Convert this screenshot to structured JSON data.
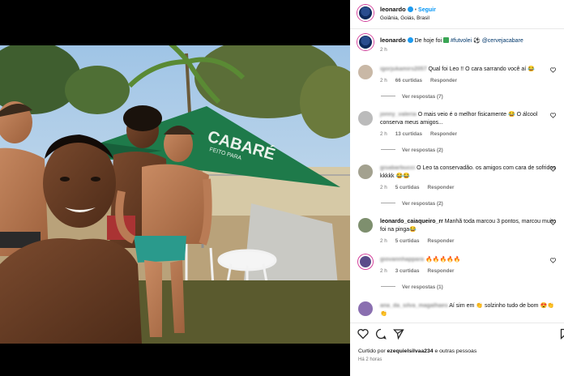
{
  "post": {
    "username": "leonardo",
    "follow_label": "Seguir",
    "location": "Goiânia, Goiás, Brasil",
    "caption_text": "De hoje foi",
    "caption_tag1": "#futvolei",
    "caption_tag2": "@cervejacabare",
    "caption_time": "2 h",
    "tent_text": "CABARÉ",
    "tent_small": "FEITO PARA"
  },
  "comments": [
    {
      "user": "igorjukamirs2057",
      "text": "Qual foi Leo !! O cara sarrando você aí 😂",
      "time": "2 h",
      "likes": "66 curtidas",
      "reply": "Responder",
      "replies": "Ver respostas (7)"
    },
    {
      "user": "jonny_valeria",
      "text": "O mais veio é o melhor fisicamente 😂 O álcool conserva meus amigos...",
      "time": "2 h",
      "likes": "13 curtidas",
      "reply": "Responder",
      "replies": "Ver respostas (2)"
    },
    {
      "user": "gisabarbucci",
      "text": "O Leo ta conservadão. os amigos com cara de sofridos kkkkk 😂😂",
      "time": "2 h",
      "likes": "5 curtidas",
      "reply": "Responder",
      "replies": "Ver respostas (2)"
    },
    {
      "user": "leonardo_caiaqueiro_rr",
      "text": "Manhã toda marcou 3 pontos, marcou muito foi na pinga😂",
      "time": "2 h",
      "likes": "5 curtidas",
      "reply": "Responder",
      "replies": ""
    },
    {
      "user": "giovannhappara",
      "text": "🔥🔥🔥🔥🔥",
      "time": "2 h",
      "likes": "3 curtidas",
      "reply": "Responder",
      "replies": "Ver respostas (1)"
    },
    {
      "user": "ana_da_silva_magalhaes",
      "text": "Aí sim em 👏 solzinho tudo de bom 😍👏👏",
      "time": "",
      "likes": "",
      "reply": "",
      "replies": ""
    }
  ],
  "footer": {
    "liked_prefix": "Curtido por",
    "liked_user": "ezequielsilvaa234",
    "liked_suffix": "e outras pessoas",
    "time": "Há 2 horas"
  },
  "icons": [
    "verified-icon",
    "heart-icon",
    "comment-icon",
    "share-icon",
    "bookmark-icon"
  ],
  "colors": {
    "accent": "#0095f6",
    "verified": "#1d9bf0",
    "tent": "#1e7a4a"
  }
}
